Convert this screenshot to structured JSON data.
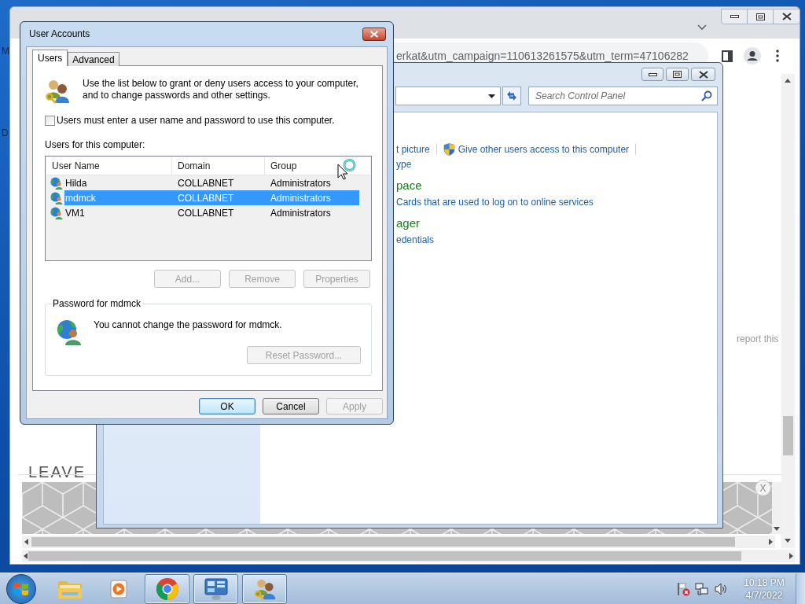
{
  "desktop": {
    "icon_labels": [
      "M",
      "D"
    ]
  },
  "browser": {
    "address": "erkat&utm_campaign=110613261575&utm_term=47106282",
    "page": {
      "heading": "LEAVE",
      "report_link": "report this",
      "ad_close": "X"
    }
  },
  "control_panel": {
    "search": {
      "placeholder": "Search Control Panel"
    },
    "lines": [
      {
        "kind": "links",
        "items": [
          {
            "text": "t picture",
            "shield": false
          },
          {
            "text": "Give other users access to this computer",
            "shield": true
          }
        ]
      },
      {
        "kind": "link",
        "text": "ype"
      },
      {
        "kind": "heading",
        "text": "pace"
      },
      {
        "kind": "link",
        "text": "Cards that are used to log on to online services"
      },
      {
        "kind": "heading",
        "text": "ager"
      },
      {
        "kind": "link",
        "text": "edentials"
      }
    ]
  },
  "user_accounts": {
    "title": "User Accounts",
    "tabs": [
      {
        "label": "Users",
        "selected": true
      },
      {
        "label": "Advanced",
        "selected": false
      }
    ],
    "intro": "Use the list below to grant or deny users access to your computer, and to change passwords and other settings.",
    "require_password": {
      "label": "Users must enter a user name and password to use this computer.",
      "checked": false
    },
    "list_label": "Users for this computer:",
    "columns": [
      "User Name",
      "Domain",
      "Group"
    ],
    "rows": [
      {
        "cells": [
          "Hilda",
          "COLLABNET",
          "Administrators"
        ],
        "selected": false
      },
      {
        "cells": [
          "mdmck",
          "COLLABNET",
          "Administrators"
        ],
        "selected": true
      },
      {
        "cells": [
          "VM1",
          "COLLABNET",
          "Administrators"
        ],
        "selected": false
      }
    ],
    "list_buttons": [
      {
        "label": "Add...",
        "disabled": true
      },
      {
        "label": "Remove",
        "disabled": true
      },
      {
        "label": "Properties",
        "disabled": true
      }
    ],
    "password": {
      "title": "Password for mdmck",
      "message": "You cannot change the password for mdmck.",
      "button": {
        "label": "Reset Password...",
        "disabled": true
      }
    },
    "buttons": [
      {
        "label": "OK",
        "default": true,
        "disabled": false
      },
      {
        "label": "Cancel",
        "default": false,
        "disabled": false
      },
      {
        "label": "Apply",
        "default": false,
        "disabled": true
      }
    ]
  },
  "taskbar": {
    "items": [
      {
        "kind": "explorer",
        "running": false
      },
      {
        "kind": "media",
        "running": false
      },
      {
        "kind": "browser",
        "running": true
      },
      {
        "kind": "control-panel",
        "running": true
      },
      {
        "kind": "users",
        "running": true
      }
    ],
    "clock": {
      "time": "10:18 PM",
      "date": "4/7/2022"
    }
  }
}
